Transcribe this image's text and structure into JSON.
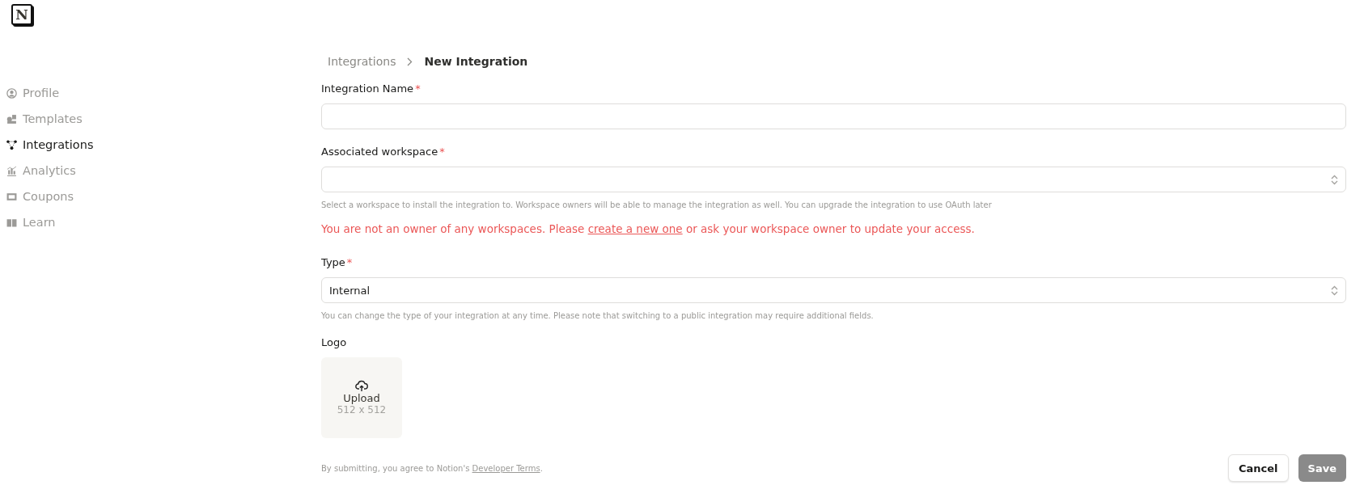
{
  "logo": {
    "letter": "N"
  },
  "sidebar": {
    "items": [
      {
        "label": "Profile",
        "selected": false
      },
      {
        "label": "Templates",
        "selected": false
      },
      {
        "label": "Integrations",
        "selected": true
      },
      {
        "label": "Analytics",
        "selected": false
      },
      {
        "label": "Coupons",
        "selected": false
      },
      {
        "label": "Learn",
        "selected": false
      }
    ]
  },
  "breadcrumb": [
    {
      "label": "Integrations",
      "current": false
    },
    {
      "label": "New Integration",
      "current": true
    }
  ],
  "fields": [
    {
      "kind": "text",
      "label": "Integration Name",
      "required_mark": "*"
    },
    {
      "kind": "select",
      "label": "Associated workspace",
      "required_mark": "*",
      "hint": "Select a workspace to install the integration to. Workspace owners will be able to manage the integration as well. You can upgrade the integration to use OAuth later",
      "error": {
        "before": "You are not an owner of any workspaces. Please ",
        "link": "create a new one",
        "after": " or ask your workspace owner to update your access."
      }
    },
    {
      "kind": "select",
      "label": "Type",
      "required_mark": "*",
      "value": "Internal",
      "hint": "You can change the type of your integration at any time. Please note that switching to a public integration may require additional fields."
    },
    {
      "kind": "upload",
      "label": "Logo",
      "upload_label": "Upload",
      "size": "512 x 512"
    }
  ],
  "footer": {
    "before": "By submitting, you agree to Notion's ",
    "link": "Developer Terms",
    "after": "."
  },
  "buttons": [
    {
      "label": "Cancel",
      "kind": "secondary",
      "disabled": false
    },
    {
      "label": "Save",
      "kind": "primary",
      "disabled": true
    }
  ]
}
